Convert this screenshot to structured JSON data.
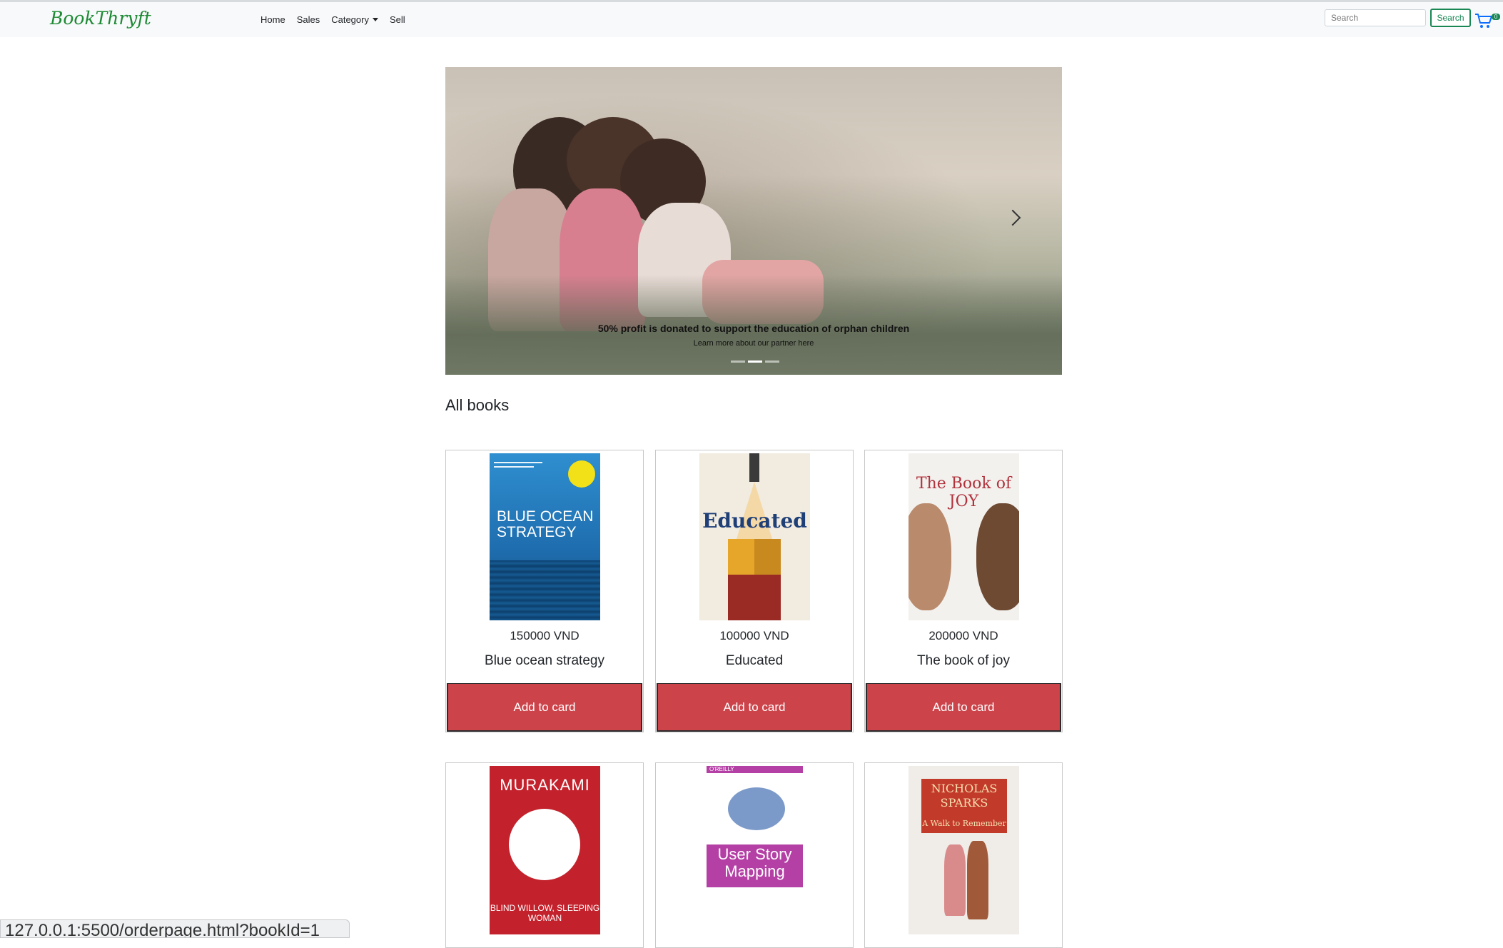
{
  "navbar": {
    "brand": "BookThryft",
    "links": [
      "Home",
      "Sales",
      "Category",
      "Sell"
    ],
    "search_placeholder": "Search",
    "search_button": "Search",
    "cart_count": "0"
  },
  "carousel": {
    "caption_title": "50% profit is donated to support the education of orphan children",
    "caption_subtitle": "Learn more about our partner here"
  },
  "section": {
    "title": "All books"
  },
  "books": [
    {
      "price": "150000 VND",
      "title": "Blue ocean strategy",
      "button": "Add to card",
      "cover_text": "BLUE OCEAN STRATEGY"
    },
    {
      "price": "100000 VND",
      "title": "Educated",
      "button": "Add to card",
      "cover_text": "Educated"
    },
    {
      "price": "200000 VND",
      "title": "The book of joy",
      "button": "Add to card",
      "cover_text": "The Book of JOY"
    },
    {
      "cover_text": "MURAKAMI",
      "cover_subtext": "BLIND WILLOW, SLEEPING WOMAN"
    },
    {
      "cover_text": "User Story Mapping",
      "cover_subtext": "O'REILLY"
    },
    {
      "cover_text": "NICHOLAS SPARKS",
      "cover_subtext": "A Walk to Remember"
    }
  ],
  "status_bar": {
    "url": "127.0.0.1:5500/orderpage.html?bookId=1"
  },
  "colors": {
    "accent_green": "#198754",
    "button_red": "#cc434a",
    "navbar_bg": "#f8f9fa"
  }
}
